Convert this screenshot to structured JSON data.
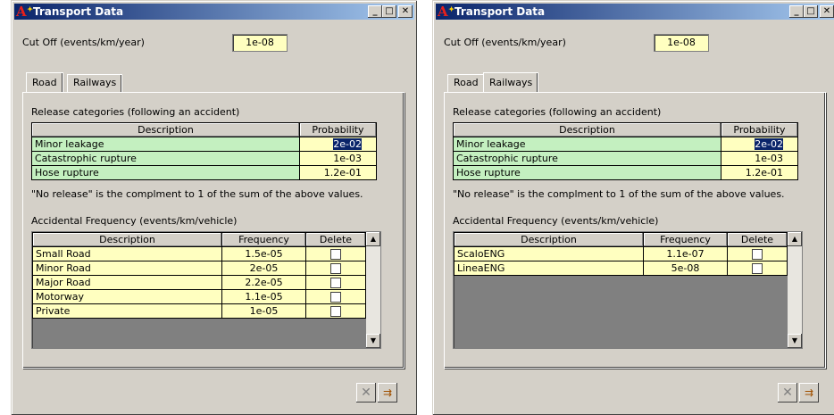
{
  "windows": [
    {
      "title": "Transport Data",
      "cutoff": {
        "label": "Cut Off (events/km/year)",
        "value": "1e-08"
      },
      "tabs": [
        {
          "label": "Road",
          "active": true
        },
        {
          "label": "Railways",
          "active": false
        }
      ],
      "release": {
        "label": "Release categories (following an accident)",
        "headers": [
          "Description",
          "Probability"
        ],
        "rows": [
          {
            "desc": "Minor leakage",
            "prob": "2e-02"
          },
          {
            "desc": "Catastrophic rupture",
            "prob": "1e-03"
          },
          {
            "desc": "Hose rupture",
            "prob": "1.2e-01"
          }
        ]
      },
      "note": "\"No release\" is the complment to 1 of the sum of the above values.",
      "accidental": {
        "label": "Accidental Frequency (events/km/vehicle)",
        "headers": [
          "Description",
          "Frequency",
          "Delete"
        ],
        "rows": [
          {
            "desc": "Small Road",
            "freq": "1.5e-05"
          },
          {
            "desc": "Minor Road",
            "freq": "2e-05"
          },
          {
            "desc": "Major Road",
            "freq": "2.2e-05"
          },
          {
            "desc": "Motorway",
            "freq": "1.1e-05"
          },
          {
            "desc": "Private",
            "freq": "1e-05"
          }
        ]
      }
    },
    {
      "title": "Transport Data",
      "cutoff": {
        "label": "Cut Off (events/km/year)",
        "value": "1e-08"
      },
      "tabs": [
        {
          "label": "Road",
          "active": false
        },
        {
          "label": "Railways",
          "active": true
        }
      ],
      "release": {
        "label": "Release categories (following an accident)",
        "headers": [
          "Description",
          "Probability"
        ],
        "rows": [
          {
            "desc": "Minor leakage",
            "prob": "2e-02"
          },
          {
            "desc": "Catastrophic rupture",
            "prob": "1e-03"
          },
          {
            "desc": "Hose rupture",
            "prob": "1.2e-01"
          }
        ]
      },
      "note": "\"No release\" is the complment to 1 of the sum of the above values.",
      "accidental": {
        "label": "Accidental Frequency (events/km/vehicle)",
        "headers": [
          "Description",
          "Frequency",
          "Delete"
        ],
        "rows": [
          {
            "desc": "ScaloENG",
            "freq": "1.1e-07"
          },
          {
            "desc": "LineaENG",
            "freq": "5e-08"
          }
        ]
      }
    }
  ]
}
